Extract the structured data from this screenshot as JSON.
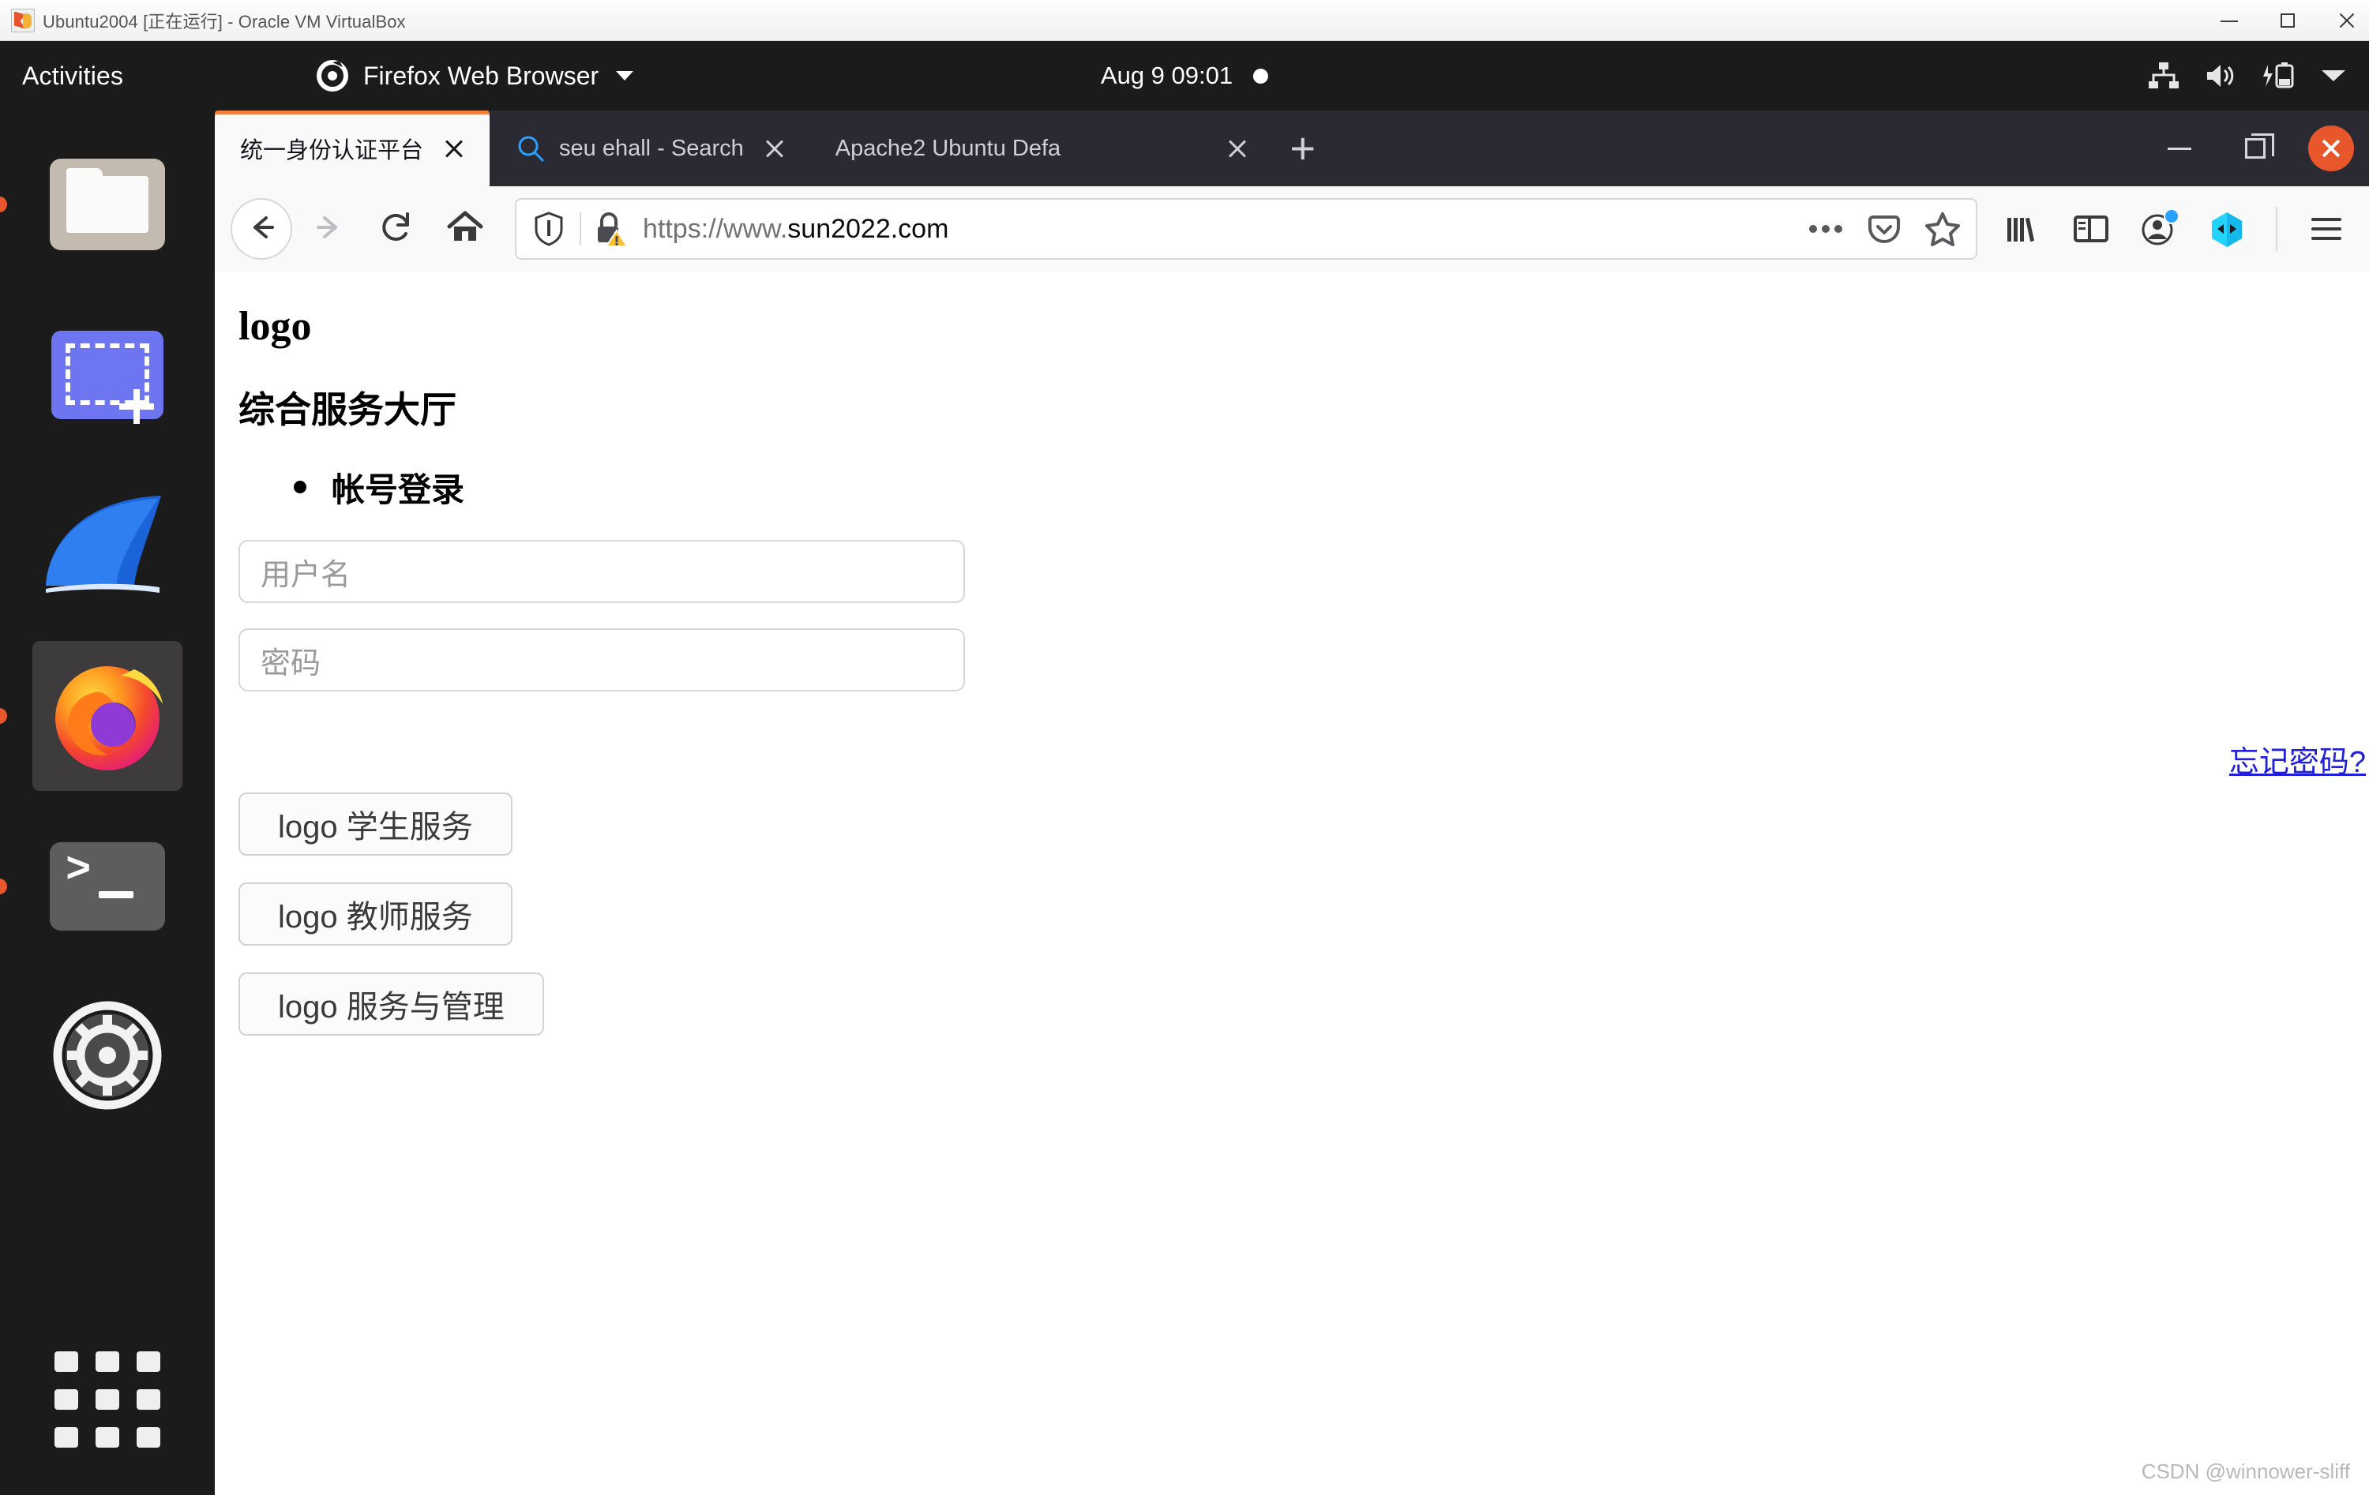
{
  "vbox": {
    "title": "Ubuntu2004 [正在运行] - Oracle VM VirtualBox",
    "icon": "virtualbox-icon",
    "minimize_label": "—",
    "maximize_label": "▢",
    "close_label": "✕"
  },
  "desktop": {
    "activities_label": "Activities",
    "app_menu_label": "Firefox Web Browser",
    "app_menu_icon": "firefox-icon",
    "clock": "Aug 9  09:01",
    "notification_indicator": "notification-dot",
    "tray_icons": [
      "network-wired-icon",
      "volume-icon",
      "battery-charging-icon",
      "chevron-down-icon"
    ],
    "dock": {
      "items": [
        {
          "name": "files",
          "icon": "files-icon",
          "running": true
        },
        {
          "name": "screenshot",
          "icon": "screenshot-selection-icon",
          "running": false
        },
        {
          "name": "wireshark",
          "icon": "wireshark-shark-fin-icon",
          "running": false
        },
        {
          "name": "firefox",
          "icon": "firefox-icon",
          "running": true,
          "focused": true
        },
        {
          "name": "terminal",
          "icon": "terminal-icon",
          "running": true
        },
        {
          "name": "settings",
          "icon": "settings-gear-icon",
          "running": false
        }
      ],
      "show_apps_label": "show-applications-grid"
    }
  },
  "browser": {
    "tabs": [
      {
        "title": "统一身份认证平台",
        "active": true,
        "icon": "none",
        "close_label": "✕"
      },
      {
        "title": "seu ehall - Search",
        "active": false,
        "icon": "search-icon",
        "close_label": "✕"
      },
      {
        "title": "Apache2 Ubuntu Defa",
        "active": false,
        "icon": "none",
        "close_label": "✕",
        "truncated": true
      }
    ],
    "new_tab_label": "+",
    "window_controls": {
      "minimize": "minimize-button",
      "restore": "restore-button",
      "close": "close-button"
    },
    "nav": {
      "back": "back-arrow-icon",
      "forward": "forward-arrow-icon",
      "reload": "reload-icon",
      "home": "home-icon"
    },
    "urlbar": {
      "shield_icon": "tracking-protection-shield-icon",
      "lock_icon": "lock-warning-icon",
      "url_scheme": "https://www.",
      "url_host": "sun2022.com",
      "url_full": "https://www.sun2022.com",
      "actions": [
        "page-actions-ellipsis-icon",
        "pocket-icon",
        "bookmark-star-icon"
      ]
    },
    "toolbar_icons": [
      "library-icon",
      "sidebar-icon",
      "account-icon",
      "extension-hexagon-icon",
      "menu-hamburger-icon"
    ],
    "account_badge": "blue-dot"
  },
  "page": {
    "logo_heading": "logo",
    "hall_heading": "综合服务大厅",
    "login_list": [
      "帐号登录"
    ],
    "username_placeholder": "用户名",
    "password_placeholder": "密码",
    "forgot_password_label": "忘记密码?",
    "service_buttons": [
      "logo 学生服务",
      "logo 教师服务",
      "logo 服务与管理"
    ],
    "watermark": "CSDN @winnower-sliff"
  },
  "colors": {
    "firefox_accent": "#f0803c",
    "ubuntu_orange": "#e8562b",
    "link_blue": "#2020d8",
    "tab_bar_dark": "#2b2a33",
    "topbar_dark": "#1b1b1b"
  }
}
